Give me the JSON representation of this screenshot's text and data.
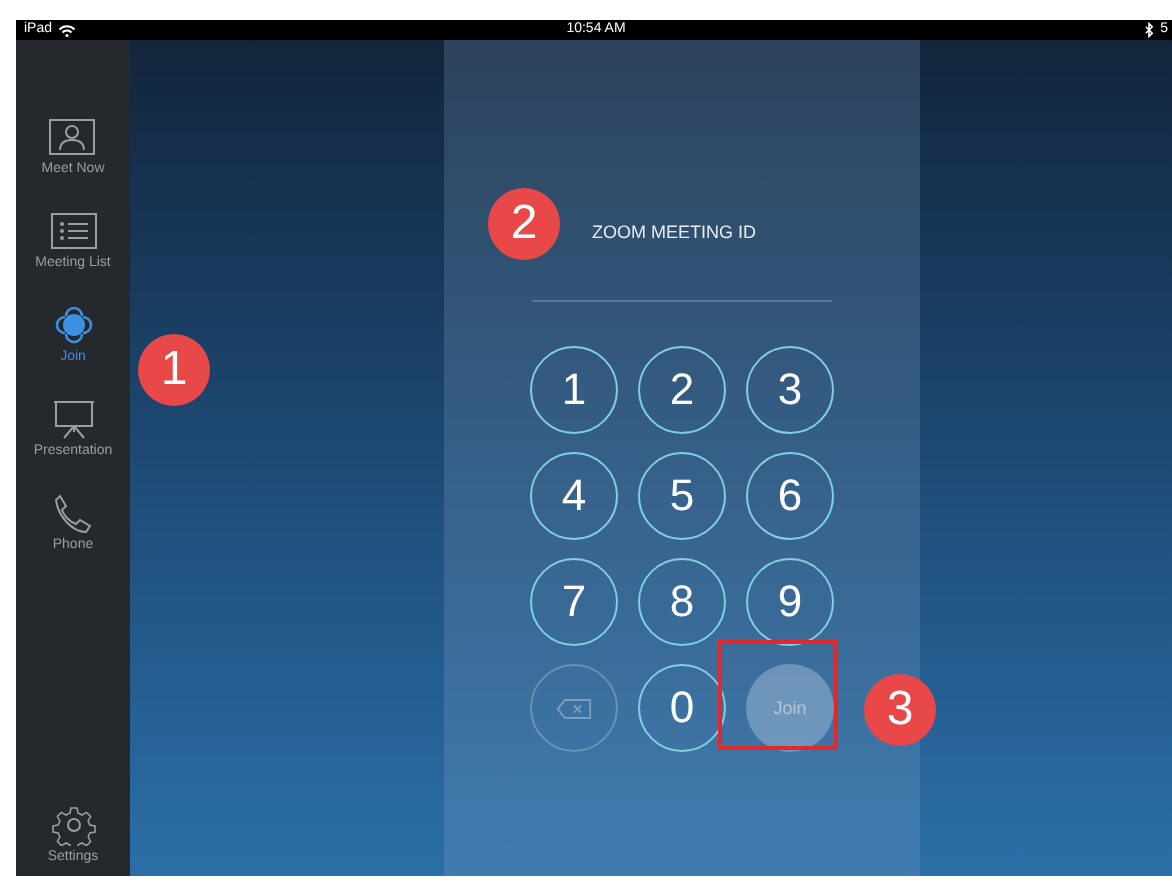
{
  "status_bar": {
    "device": "iPad",
    "time": "10:54 AM",
    "battery": "5"
  },
  "sidebar": {
    "items": [
      {
        "kind": "meet",
        "label": "Meet Now",
        "selected": false
      },
      {
        "kind": "list",
        "label": "Meeting List",
        "selected": false
      },
      {
        "kind": "join",
        "label": "Join",
        "selected": true
      },
      {
        "kind": "presentation",
        "label": "Presentation",
        "selected": false
      },
      {
        "kind": "phone",
        "label": "Phone",
        "selected": false
      }
    ],
    "settings": {
      "kind": "settings",
      "label": "Settings",
      "selected": false
    }
  },
  "keypad": {
    "label": "ZOOM MEETING ID",
    "keys": [
      {
        "kind": "digit",
        "text": "1"
      },
      {
        "kind": "digit",
        "text": "2"
      },
      {
        "kind": "digit",
        "text": "3"
      },
      {
        "kind": "digit",
        "text": "4"
      },
      {
        "kind": "digit",
        "text": "5"
      },
      {
        "kind": "digit",
        "text": "6"
      },
      {
        "kind": "digit",
        "text": "7"
      },
      {
        "kind": "digit",
        "text": "8"
      },
      {
        "kind": "digit",
        "text": "9"
      },
      {
        "kind": "delete",
        "disabled": true
      },
      {
        "kind": "digit",
        "text": "0"
      },
      {
        "kind": "join",
        "text": "Join",
        "disabled": true,
        "highlighted": true
      }
    ]
  },
  "callouts": [
    {
      "number": "1",
      "kind": "sidebar"
    },
    {
      "number": "2",
      "kind": "label"
    },
    {
      "number": "3",
      "kind": "join"
    }
  ]
}
